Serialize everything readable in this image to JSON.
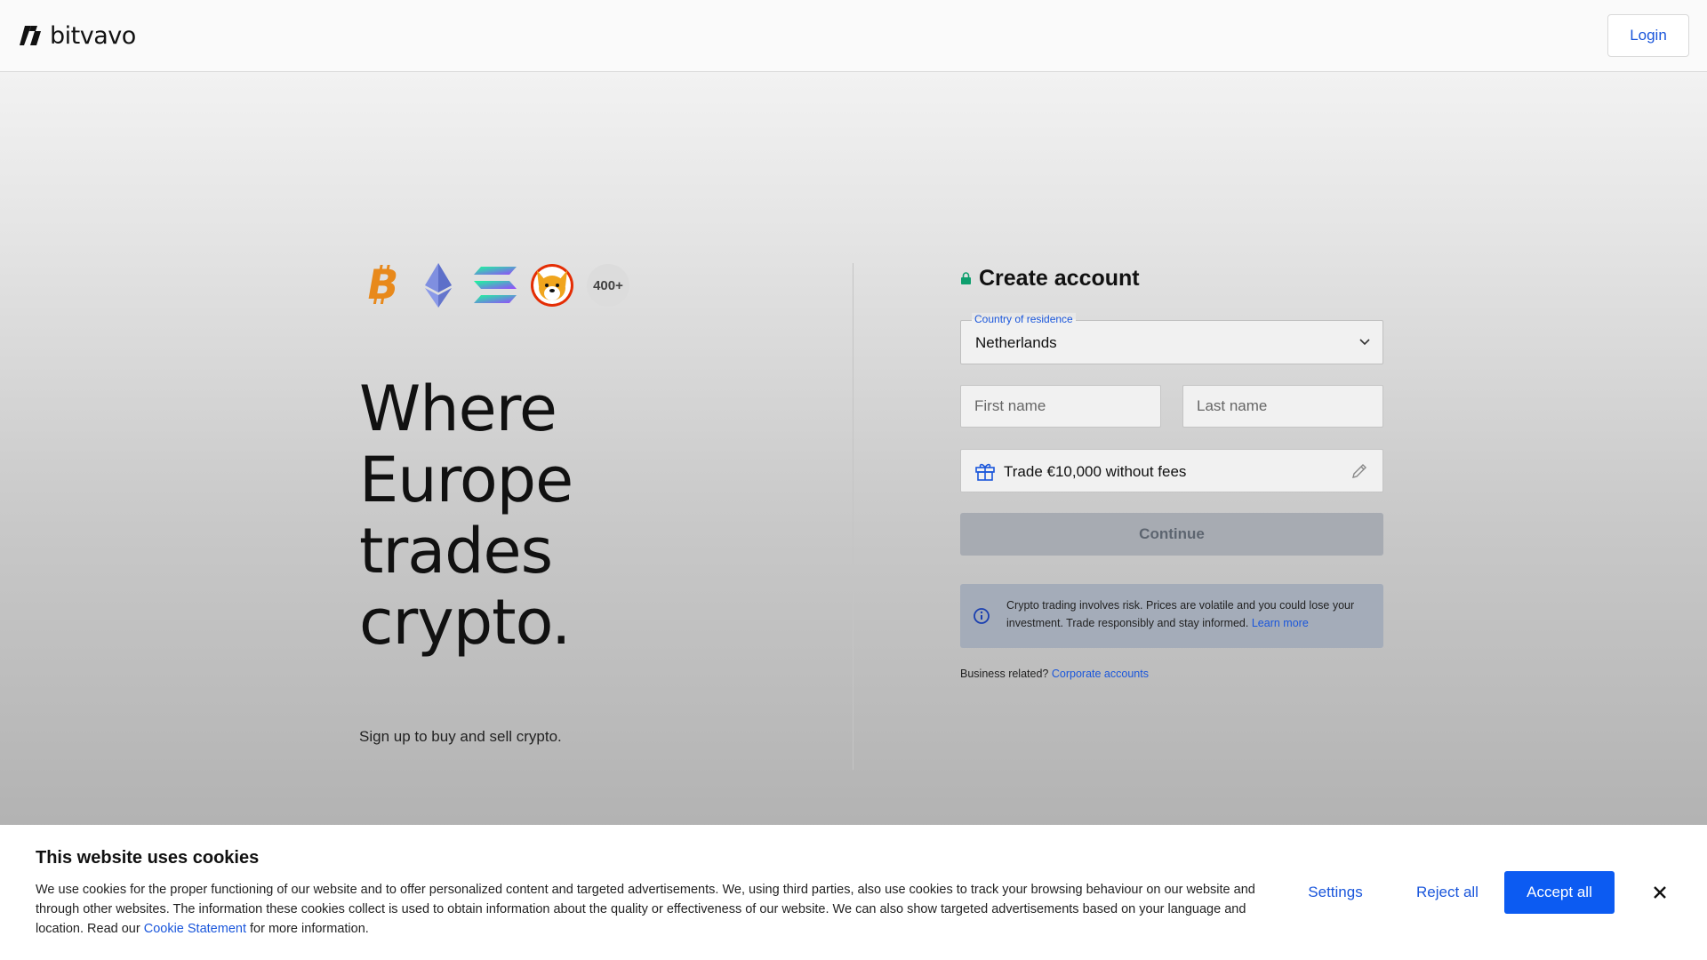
{
  "header": {
    "logo_text": "bitvavo",
    "login_label": "Login"
  },
  "hero": {
    "coins": [
      "bitcoin-icon",
      "ethereum-icon",
      "solana-icon",
      "shiba-inu-icon"
    ],
    "more_label": "400+",
    "title_lines": [
      "Where",
      "Europe",
      "trades",
      "crypto."
    ],
    "subtitle": "Sign up to buy and sell crypto."
  },
  "form": {
    "title": "Create account",
    "country_label": "Country of residence",
    "country_value": "Netherlands",
    "first_name_placeholder": "First name",
    "last_name_placeholder": "Last name",
    "promo_text": "Trade €10,000 without fees",
    "continue_label": "Continue",
    "risk_text": "Crypto trading involves risk. Prices are volatile and you could lose your investment. Trade responsibly and stay informed.",
    "risk_link": "Learn more",
    "business_text": "Business related?",
    "business_link": "Corporate accounts"
  },
  "cookie": {
    "title": "This website uses cookies",
    "text_before": "We use cookies for the proper functioning of our website and to offer personalized content and targeted advertisements. We, using third parties, also use cookies to track your browsing behaviour on our website and through other websites. The information these cookies collect is used to obtain information about the quality or effectiveness of our website. We can also show targeted advertisements based on your language and location. Read our",
    "link": "Cookie Statement",
    "text_after": "for more information.",
    "settings_label": "Settings",
    "reject_label": "Reject all",
    "accept_label": "Accept all"
  },
  "colors": {
    "accent": "#1a56db",
    "accept_button": "#0c5bf2",
    "continue_disabled": "#a7abb2",
    "lock": "#0e9f6e"
  }
}
